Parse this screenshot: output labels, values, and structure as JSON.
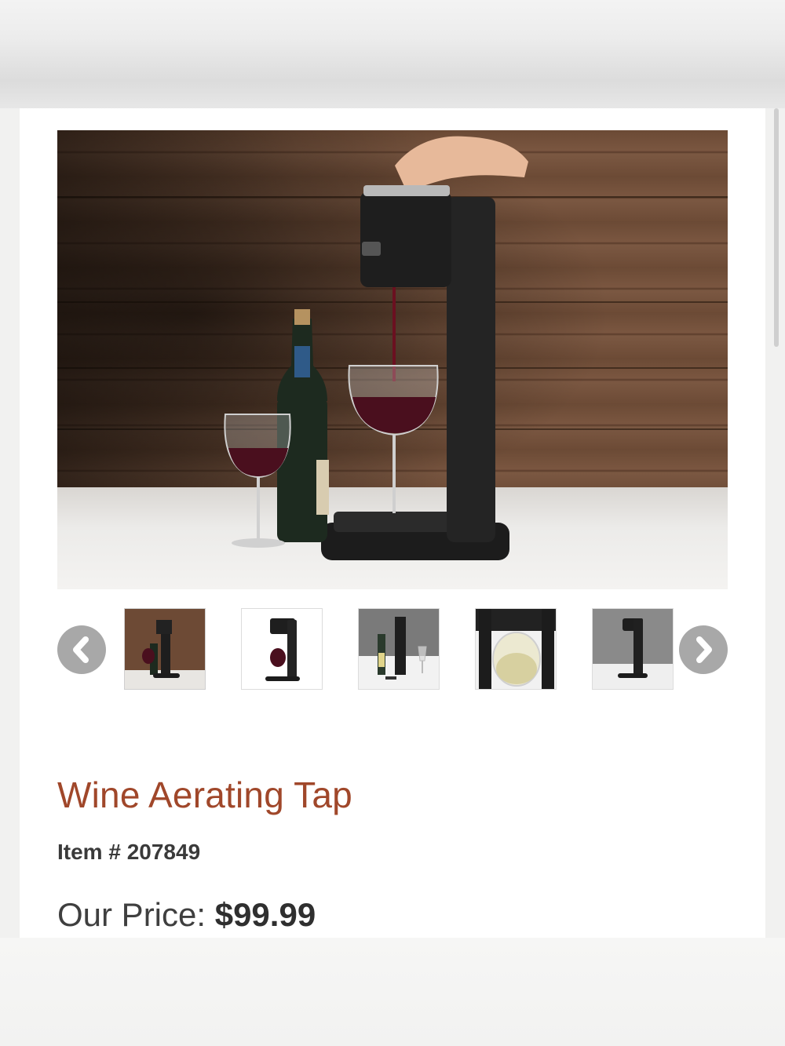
{
  "product": {
    "title": "Wine Aerating Tap",
    "item_label": "Item #",
    "item_number": "207849",
    "price_label": "Our Price:",
    "price": "$99.99"
  },
  "gallery": {
    "prev_icon": "chevron-left-icon",
    "next_icon": "chevron-right-icon",
    "thumbnail_count": 5,
    "selected_index": 0
  },
  "colors": {
    "title": "#a0472a",
    "text": "#3a3a3a",
    "arrow": "#a8a8a8"
  }
}
